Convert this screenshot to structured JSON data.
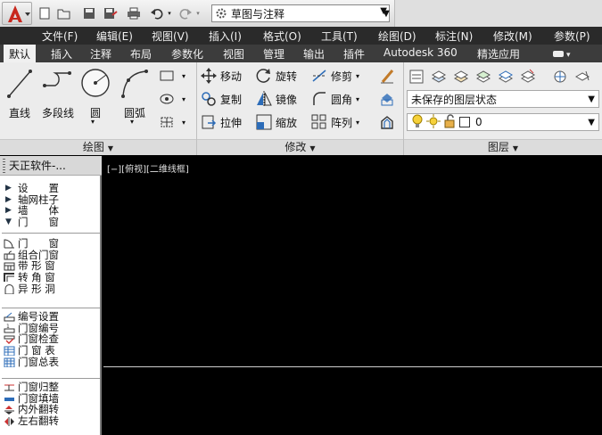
{
  "titlebar": {
    "workspace": "草图与注释",
    "logo_letter": "A",
    "accent": "#c8281e"
  },
  "menubar": {
    "items": [
      "文件(F)",
      "编辑(E)",
      "视图(V)",
      "插入(I)",
      "格式(O)",
      "工具(T)",
      "绘图(D)",
      "标注(N)",
      "修改(M)",
      "参数(P)"
    ]
  },
  "ribbon_tabs": {
    "items": [
      "默认",
      "插入",
      "注释",
      "布局",
      "参数化",
      "视图",
      "管理",
      "输出",
      "插件",
      "Autodesk 360",
      "精选应用"
    ],
    "active": "默认"
  },
  "draw_panel": {
    "title": "绘图",
    "tools": [
      "直线",
      "多段线",
      "圆",
      "圆弧"
    ]
  },
  "modify_panel": {
    "title": "修改",
    "tools": [
      "移动",
      "旋转",
      "修剪",
      "复制",
      "镜像",
      "圆角",
      "拉伸",
      "缩放",
      "阵列"
    ]
  },
  "layer_panel": {
    "title": "图层",
    "state_combo": "未保存的图层状态",
    "current_layer": "0"
  },
  "palette": {
    "title": "天正软件-...",
    "groups": [
      [
        "设　　置",
        "轴网柱子",
        "墙　　体",
        "门　　窗"
      ],
      [
        "门　　窗",
        "组合门窗",
        "带 形 窗",
        "转 角 窗",
        "异 形 洞"
      ],
      [
        "编号设置",
        "门窗编号",
        "门窗检查",
        "门 窗 表",
        "门窗总表"
      ],
      [
        "门窗归整",
        "门窗填墙",
        "内外翻转",
        "左右翻转"
      ]
    ]
  },
  "viewport": {
    "label": "[−][俯视][二维线框]"
  }
}
